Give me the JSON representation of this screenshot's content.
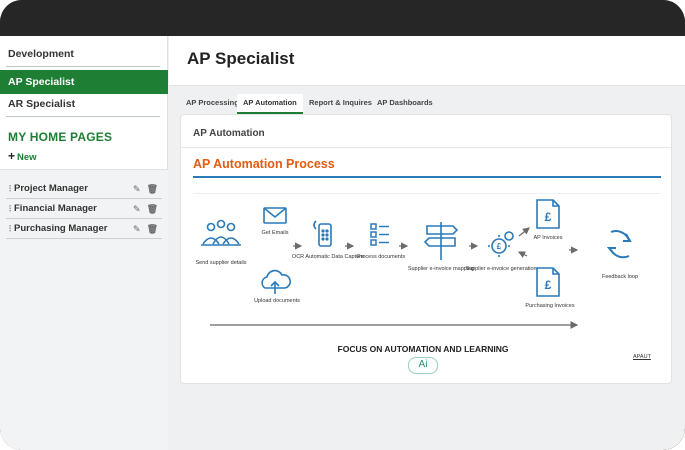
{
  "sidebar": {
    "items": [
      {
        "label": "Development"
      },
      {
        "label": "AP Specialist"
      },
      {
        "label": "AR Specialist"
      }
    ],
    "home_pages_title": "MY HOME PAGES",
    "new_label": "New",
    "pages": [
      {
        "label": "Project Manager"
      },
      {
        "label": "Financial Manager"
      },
      {
        "label": "Purchasing Manager"
      }
    ]
  },
  "header": {
    "title": "AP Specialist"
  },
  "tabs": [
    {
      "label": "AP Processing"
    },
    {
      "label": "AP Automation"
    },
    {
      "label": "Report & Inquires"
    },
    {
      "label": "AP Dashboards"
    }
  ],
  "card": {
    "title": "AP Automation",
    "process_title": "AP Automation Process"
  },
  "diagram": {
    "steps": {
      "send_supplier_details": "Send supplier details",
      "get_emails": "Get Emails",
      "upload_documents": "Upload documents",
      "ocr": "OCR Automatic Data Capture",
      "process_documents": "Process documents",
      "mapping": "Supplier e-invoice mapping",
      "generation": "Supplier e-invoice generation",
      "ap_invoices": "AP Invoices",
      "purchasing_invoices": "Purchasing Invoices",
      "feedback_loop": "Feedback loop"
    },
    "currency_symbol": "£",
    "focus_label": "FOCUS ON AUTOMATION AND LEARNING",
    "ai_label": "Ai",
    "footnote": "APAUT"
  },
  "colors": {
    "accent": "#1e7e34",
    "orange": "#e25b12",
    "blue": "#2a7ab8"
  }
}
